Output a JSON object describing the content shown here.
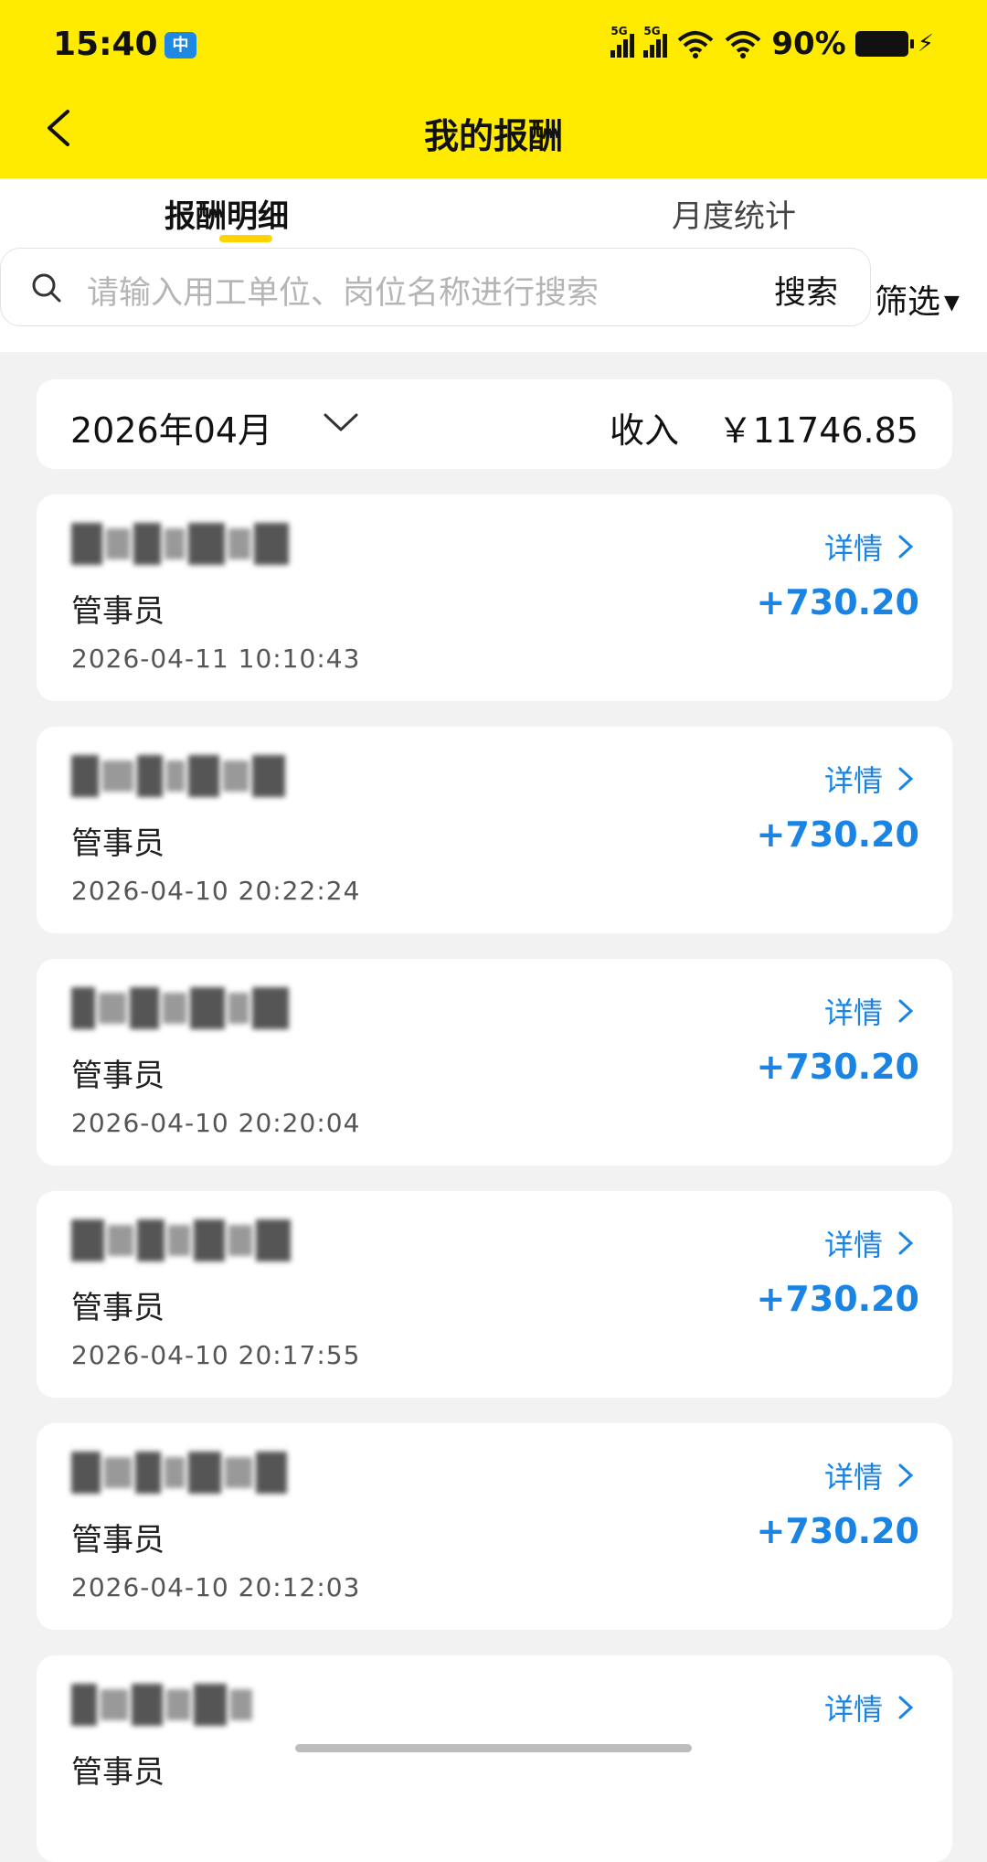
{
  "status_bar": {
    "time": "15:40",
    "app_badge": "中",
    "signal1": "5G",
    "signal2": "5G",
    "battery_pct": "90%"
  },
  "nav": {
    "title": "我的报酬"
  },
  "tabs": [
    {
      "label": "报酬明细",
      "active": true
    },
    {
      "label": "月度统计",
      "active": false
    }
  ],
  "search": {
    "placeholder": "请输入用工单位、岗位名称进行搜索",
    "button_label": "搜索",
    "filter_label": "筛选"
  },
  "summary": {
    "month": "2026年04月",
    "income_label": "收入",
    "income_value": "￥11746.85"
  },
  "records": [
    {
      "role": "管事员",
      "time": "2026-04-11 10:10:43",
      "detail_label": "详情",
      "amount": "+730.20"
    },
    {
      "role": "管事员",
      "time": "2026-04-10 20:22:24",
      "detail_label": "详情",
      "amount": "+730.20"
    },
    {
      "role": "管事员",
      "time": "2026-04-10 20:20:04",
      "detail_label": "详情",
      "amount": "+730.20"
    },
    {
      "role": "管事员",
      "time": "2026-04-10 20:17:55",
      "detail_label": "详情",
      "amount": "+730.20"
    },
    {
      "role": "管事员",
      "time": "2026-04-10 20:12:03",
      "detail_label": "详情",
      "amount": "+730.20"
    },
    {
      "role": "管事员",
      "time": "",
      "detail_label": "详情",
      "amount": ""
    }
  ],
  "colors": {
    "header": "#ffeb00",
    "accent_blue": "#1a84e4",
    "tab_underline": "#ffd400"
  }
}
